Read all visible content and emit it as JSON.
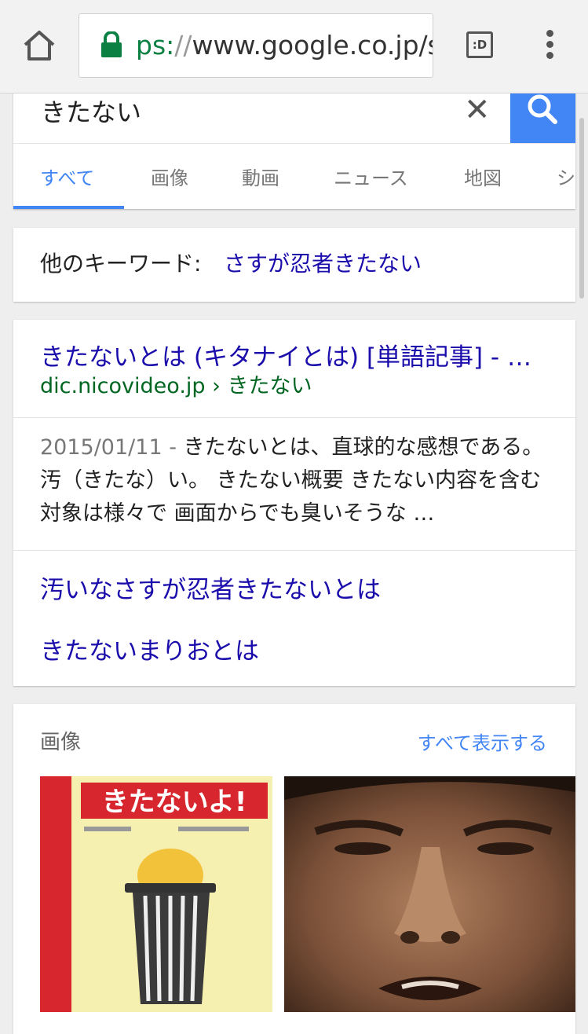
{
  "browser": {
    "url_scheme": "ps:",
    "url_sep": "//",
    "url_host": "www.google.co.jp/s",
    "tabs_label": ":D"
  },
  "search": {
    "query": "きたない",
    "clear_glyph": "✕"
  },
  "tabs": [
    {
      "label": "すべて",
      "active": true
    },
    {
      "label": "画像",
      "active": false
    },
    {
      "label": "動画",
      "active": false
    },
    {
      "label": "ニュース",
      "active": false
    },
    {
      "label": "地図",
      "active": false
    },
    {
      "label": "シ",
      "active": false
    }
  ],
  "keywords": {
    "label": "他のキーワード:",
    "link": "さすが忍者きたない"
  },
  "result": {
    "title": "きたないとは (キタナイとは) [単語記事] - …",
    "url": "dic.nicovideo.jp › きたない",
    "date": "2015/01/11 - ",
    "snippet": "きたないとは、直球的な感想である。汚（きたな）い。 きたない概要 きたない内容を含む対象は様々で 画面からでも臭いそうな …",
    "sublinks": [
      "汚いなさすが忍者きたないとは",
      "きたないまりおとは"
    ]
  },
  "images": {
    "heading": "画像",
    "see_all": "すべて表示する",
    "book_title": "きたないよ!"
  },
  "colors": {
    "accent": "#4285f4",
    "link": "#1a0dab",
    "url_green": "#006621"
  }
}
